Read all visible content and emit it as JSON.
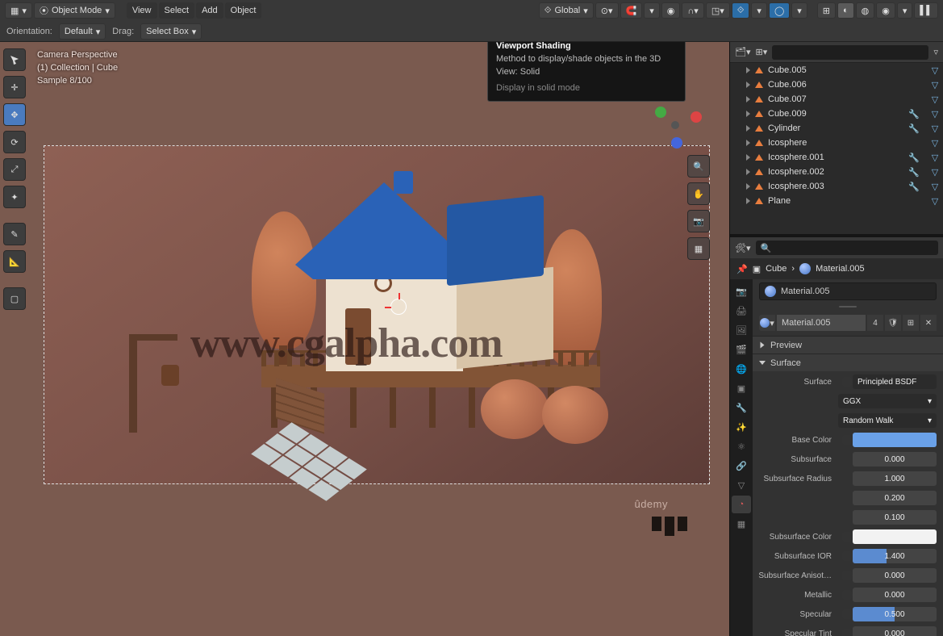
{
  "header": {
    "mode": "Object Mode",
    "menus": [
      "View",
      "Select",
      "Add",
      "Object"
    ],
    "orient_space": "Global",
    "orientation_label": "Orientation:",
    "orientation_value": "Default",
    "drag_label": "Drag:",
    "drag_value": "Select Box"
  },
  "tooltip": {
    "title": "Viewport Shading",
    "body": "Method to display/shade objects in the 3D View: Solid",
    "footer": "Display in solid mode"
  },
  "viewport": {
    "line1": "Camera Perspective",
    "line2": "(1) Collection | Cube",
    "line3": "Sample 8/100",
    "watermark": "www.cgalpha.com",
    "credit": "ûdemy"
  },
  "outliner": {
    "items": [
      {
        "name": "Cube.005",
        "mat": true
      },
      {
        "name": "Cube.006",
        "mat": true
      },
      {
        "name": "Cube.007",
        "mat": true
      },
      {
        "name": "Cube.009",
        "mat2": true
      },
      {
        "name": "Cylinder",
        "mat2": true
      },
      {
        "name": "Icosphere",
        "mat": true
      },
      {
        "name": "Icosphere.001",
        "mat2": true
      },
      {
        "name": "Icosphere.002",
        "mat2": true
      },
      {
        "name": "Icosphere.003",
        "mat2": true
      },
      {
        "name": "Plane",
        "mat": true
      }
    ]
  },
  "breadcrumb": {
    "obj": "Cube",
    "mat": "Material.005"
  },
  "material": {
    "slot": "Material.005",
    "name": "Material.005",
    "users": "4"
  },
  "panels": {
    "preview": "Preview",
    "surface": "Surface"
  },
  "surface": {
    "label": "Surface",
    "shader": "Principled BSDF",
    "dist": "GGX",
    "sss_method": "Random Walk",
    "rows": [
      {
        "label": "Base Color",
        "type": "color",
        "value": "#6aa1e8",
        "dot": true
      },
      {
        "label": "Subsurface",
        "type": "num",
        "value": "0.000",
        "fill": 0
      },
      {
        "label": "Subsurface Radius",
        "type": "num",
        "value": "1.000",
        "fill": 0
      },
      {
        "label": "",
        "type": "num",
        "value": "0.200",
        "fill": 0
      },
      {
        "label": "",
        "type": "num",
        "value": "0.100",
        "fill": 0
      },
      {
        "label": "Subsurface Color",
        "type": "color",
        "value": "#f2f2f2",
        "dot": true
      },
      {
        "label": "Subsurface IOR",
        "type": "num",
        "value": "1.400",
        "fill": 40,
        "dot": true
      },
      {
        "label": "Subsurface Anisot…",
        "type": "num",
        "value": "0.000",
        "fill": 0,
        "dot": true
      },
      {
        "label": "Metallic",
        "type": "num",
        "value": "0.000",
        "fill": 0,
        "dot": true
      },
      {
        "label": "Specular",
        "type": "num",
        "value": "0.500",
        "fill": 50,
        "dot": true
      },
      {
        "label": "Specular Tint",
        "type": "num",
        "value": "0.000",
        "fill": 0,
        "dot": true
      }
    ]
  }
}
